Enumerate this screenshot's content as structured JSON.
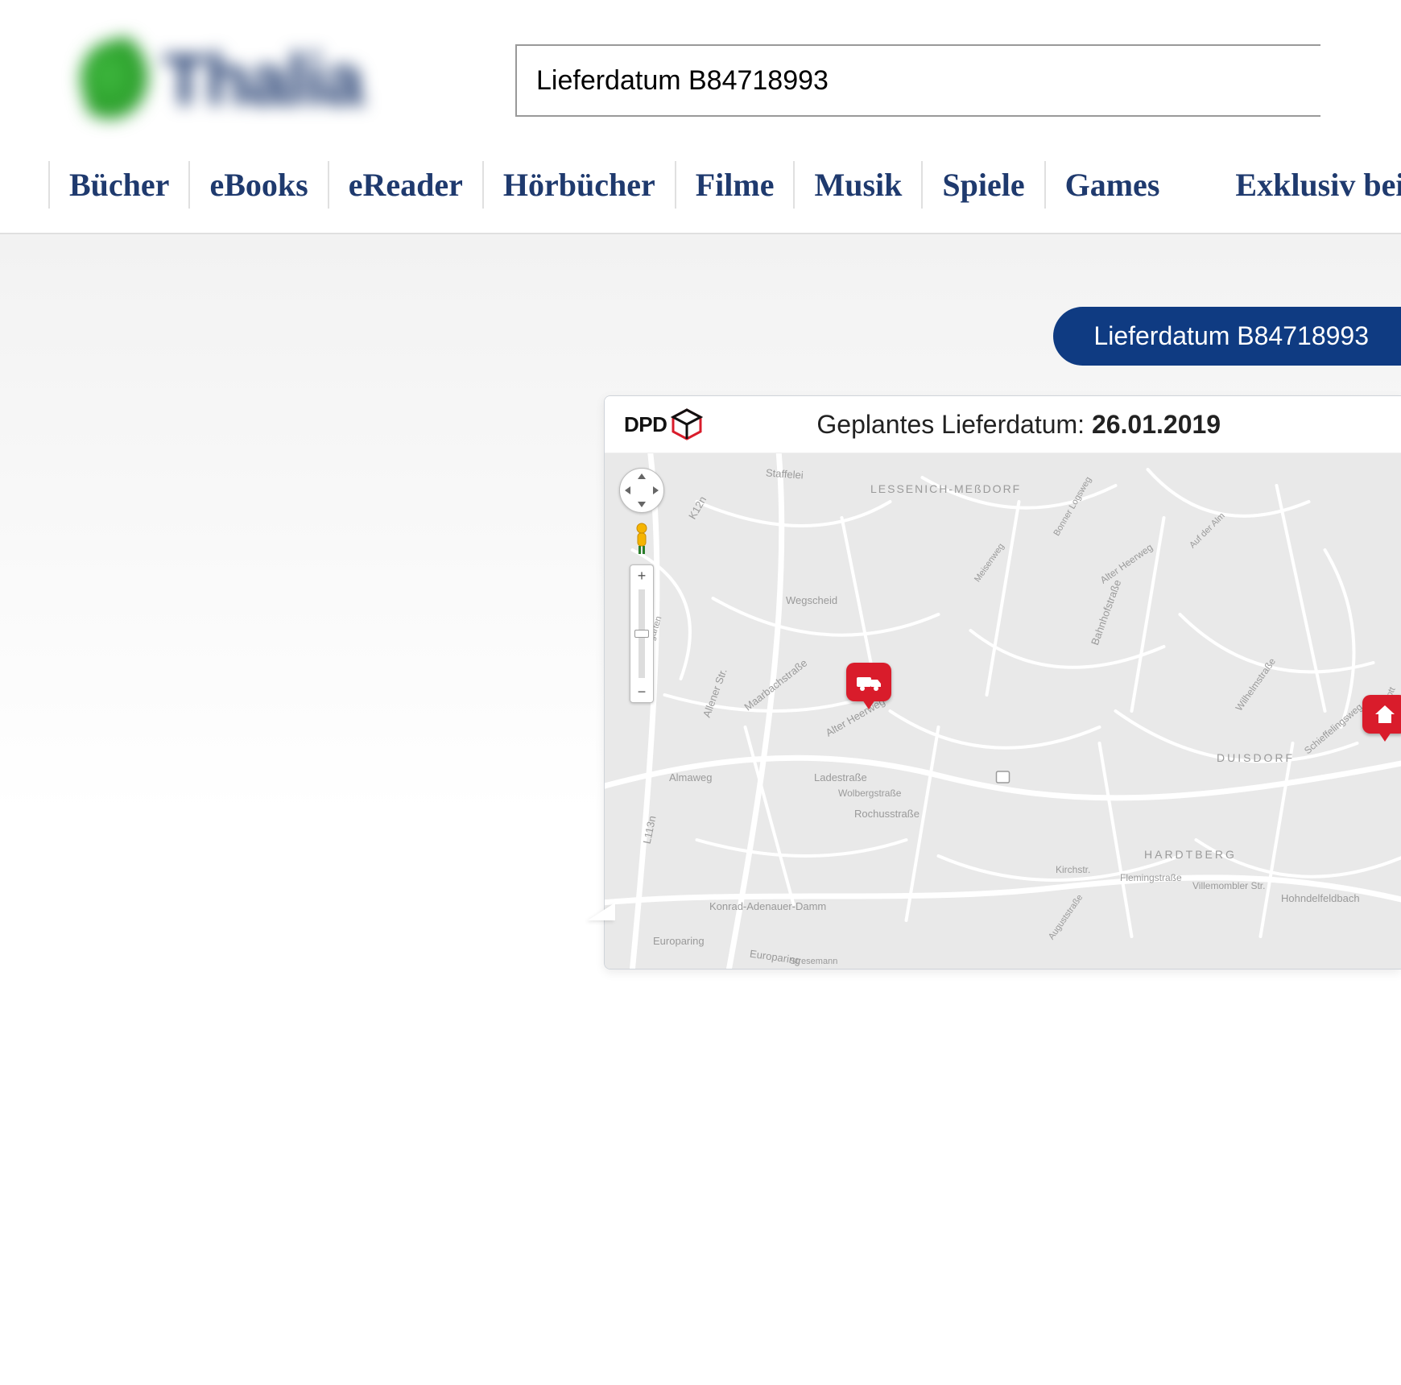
{
  "logo_text": "Thalia",
  "search": {
    "value": "Lieferdatum B84718993"
  },
  "nav": {
    "items": [
      "Bücher",
      "eBooks",
      "eReader",
      "Hörbücher",
      "Filme",
      "Musik",
      "Spiele",
      "Games"
    ],
    "exclusive": "Exklusiv bei Thalia"
  },
  "chat": {
    "user_query": "Lieferdatum B84718993"
  },
  "tracking": {
    "carrier": "DPD",
    "label": "Geplantes Lieferdatum: ",
    "date": "26.01.2019"
  },
  "map": {
    "districts": {
      "lessenich": "LESSENICH-MEßDORF",
      "duisdorf": "DUISDORF",
      "hardtberg": "HARDTBERG"
    },
    "streets": {
      "staffelei": "Staffelei",
      "k12n": "K12n",
      "wegscheid": "Wegscheid",
      "maarbachstr": "Maarbachstraße",
      "alter_heerweg": "Alter Heerweg",
      "bahnhofstr": "Bahnhofstraße",
      "rochus": "Rochusstraße",
      "ladestr": "Ladestraße",
      "wolbergstr": "Wolbergstraße",
      "almaweg": "Almaweg",
      "allener": "Allener Str.",
      "konrad": "Konrad-Adenauer-Damm",
      "europaring1": "Europaring",
      "europaring2": "Europaring",
      "stresemann": "Stresemann",
      "im_klostergarten": "Im Klostergarten",
      "l113n": "L113n",
      "alter_heerweg2": "Alter Heerweg",
      "schieffelings": "Schieffelingsweg",
      "wilhelmstr": "Wilhelmstraße",
      "kirchstr": "Kirchstr.",
      "flemingstr": "Flemingstraße",
      "hohnfeld": "Hohndelfeldbach",
      "villemombler": "Villemombler Str.",
      "auguststr": "Auguststraße",
      "bonner_logsweg": "Bonner Logsweg",
      "auf_der_alm": "Auf der Alm",
      "meisenweg": "Meisenweg",
      "im_feldpott": "Im Feldpott"
    },
    "zoom": {
      "plus": "+",
      "minus": "−"
    }
  }
}
